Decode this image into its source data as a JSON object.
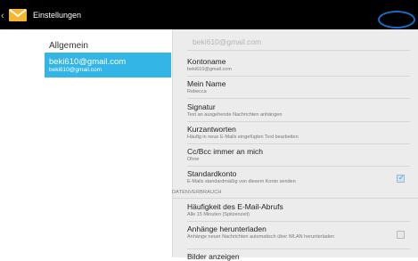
{
  "actionbar": {
    "title": "Einstellungen",
    "back_icon": "chevron-left-icon",
    "app_icon": "email-app-icon"
  },
  "left_pane": {
    "general_label": "Allgemein",
    "account": {
      "name": "beki610@gmail.com",
      "email": "beki610@gmail.com"
    }
  },
  "right_pane": {
    "header": "beki610@gmail.com",
    "items": [
      {
        "title": "Kontoname",
        "summary": "beki610@gmail.com"
      },
      {
        "title": "Mein Name",
        "summary": "Rebecca"
      },
      {
        "title": "Signatur",
        "summary": "Text an ausgehende Nachrichten anhängen"
      },
      {
        "title": "Kurzantworten",
        "summary": "Häufig in neue E-Mails eingefügten Text bearbeiten"
      },
      {
        "title": "Cc/Bcc immer an mich",
        "summary": "Ohne"
      },
      {
        "title": "Standardkonto",
        "summary": "E-Mails standardmäßig von diesem Konto senden",
        "checked": true
      }
    ],
    "section_label": "DATENVERBRAUCH",
    "data_items": [
      {
        "title": "Häufigkeit des E-Mail-Abrufs",
        "summary": "Alle 15 Minuten (Spitzenzeit)"
      },
      {
        "title": "Anhänge herunterladen",
        "summary": "Anhänge neuer Nachrichten automatisch über WLAN herunterladen",
        "checked": false
      },
      {
        "title": "Bilder anzeigen"
      }
    ]
  },
  "colors": {
    "actionbar_bg": "#000000",
    "selection_bg": "#33b5e5",
    "highlight_oval": "#1a6bc4",
    "pane_bg": "#ececec"
  }
}
